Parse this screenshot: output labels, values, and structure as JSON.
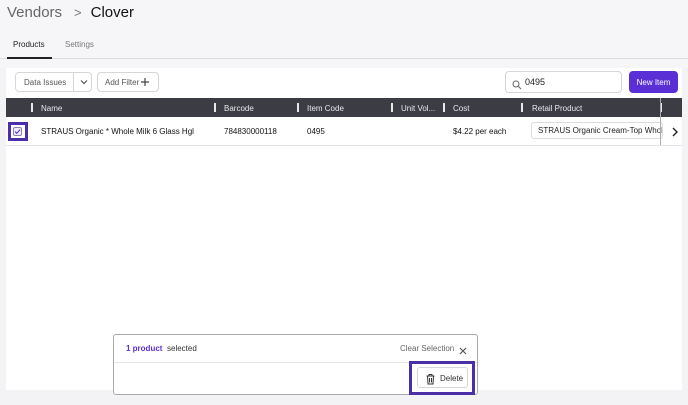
{
  "breadcrumb": {
    "root": "Vendors",
    "separator": ">",
    "current": "Clover"
  },
  "tabs": [
    {
      "label": "Products"
    },
    {
      "label": "Settings"
    }
  ],
  "toolbar": {
    "data_issues_label": "Data Issues",
    "add_filter_label": "Add Filter",
    "search_value": "0495",
    "new_item_label": "New Item"
  },
  "table": {
    "columns": [
      "Name",
      "Barcode",
      "Item Code",
      "Unit Vol...",
      "Cost",
      "Retail Product"
    ],
    "rows": [
      {
        "name": "STRAUS Organic * Whole Milk 6 Glass Hgl",
        "barcode": "784830000118",
        "item_code": "0495",
        "unit_volume": "",
        "cost": "$4.22 per each",
        "retail_product": "STRAUS Organic Cream-Top Whole Milk",
        "selected": true
      }
    ]
  },
  "selection_bar": {
    "count_label": "1 product",
    "suffix": "selected",
    "clear_label": "Clear Selection",
    "delete_label": "Delete"
  },
  "colors": {
    "accent": "#5a2fd6",
    "header_bg": "#3b3c44",
    "highlight": "#4a2fa8"
  },
  "icons": [
    "chevron-right-icon",
    "chevron-down-icon",
    "plus-icon",
    "search-icon",
    "check-icon",
    "close-icon",
    "trash-icon"
  ]
}
